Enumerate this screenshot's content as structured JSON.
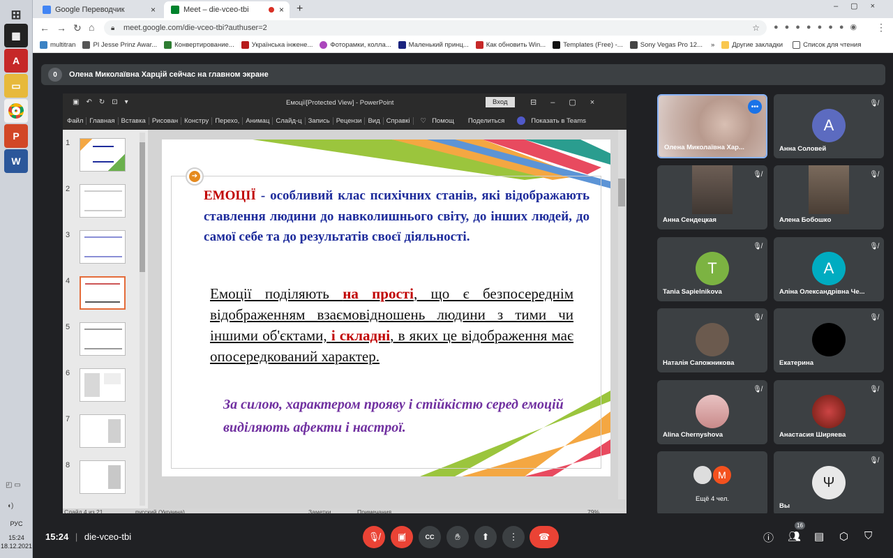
{
  "taskbar": {
    "lang": "РУС",
    "time": "15:24",
    "date": "18.12.2021"
  },
  "tabs": [
    {
      "label": "Google Переводчик"
    },
    {
      "label": "Meet – die-vceo-tbi"
    }
  ],
  "address": {
    "url": "meet.google.com/die-vceo-tbi?authuser=2"
  },
  "bookmarks": {
    "items": [
      "multitran",
      "PI Jesse Prinz Awar...",
      "Конвертирование...",
      "Українська інжене...",
      "Фоторамки, колла...",
      "Маленький принц...",
      "Как обновить Win...",
      "Templates (Free) -...",
      "Sony Vegas Pro 12..."
    ],
    "more": "»",
    "other": "Другие закладки",
    "reading": "Список для чтения"
  },
  "banner": {
    "badge": "0",
    "text": "Олена Миколаївна Харцій сейчас на главном экране"
  },
  "ppt": {
    "title": "Емоції[Protected View]  -  PowerPoint",
    "login": "Вход",
    "ribbon": [
      "Файл",
      "Главная",
      "Вставка",
      "Рисован",
      "Констру",
      "Перехо,",
      "Анимац",
      "Слайд-ц",
      "Запись",
      "Рецензи",
      "Вид",
      "Справкі"
    ],
    "help": "Помощ",
    "share": "Поделиться",
    "teams": "Показать в Teams",
    "thumb_numbers": [
      "1",
      "2",
      "3",
      "4",
      "5",
      "6",
      "7",
      "8"
    ],
    "status": {
      "slide": "Слайд 4 из 21",
      "lang": "русский (Украина)",
      "notes": "Заметки",
      "comments": "Примечания",
      "zoom": "79%"
    },
    "slide": {
      "p1_red": "ЕМОЦІЇ",
      "p1_rest": " - особливий клас психічних станів, які відображають ставлення людини до навколишнього світу, до інших людей, до самої себе та до результатів своєї діяльності.",
      "p2_a": "Емоції поділяють ",
      "p2_red1": "на прості",
      "p2_b": ", що є безпосереднім відображенням взаємовідношень людини з тими чи іншими об'єктами, ",
      "p2_red2": "і складні",
      "p2_c": ", в яких це відображення має опосередкований характер.",
      "p3": "За силою, характером прояву і стійкістю серед емоцій виділяють афекти і настрої."
    }
  },
  "participants": [
    {
      "name": "Олена Миколаївна Хар...",
      "type": "video",
      "color": "#b89a8e"
    },
    {
      "name": "Анна Соловей",
      "letter": "A",
      "color": "#5c6bc0"
    },
    {
      "name": "Анна Сендецкая",
      "type": "video",
      "color": "#6d5e55"
    },
    {
      "name": "Алена Бобошко",
      "type": "video",
      "color": "#7a6a5c"
    },
    {
      "name": "Tania Sapielnikova",
      "letter": "T",
      "color": "#7cb342"
    },
    {
      "name": "Аліна Олександрівна Че...",
      "letter": "A",
      "color": "#00acc1"
    },
    {
      "name": "Наталія Сапожникова",
      "type": "photo",
      "color": "#6b5a4e"
    },
    {
      "name": "Екатерина",
      "type": "photo",
      "color": "#000000"
    },
    {
      "name": "Alina Chernyshova",
      "type": "photo",
      "color": "#d9a6a6"
    },
    {
      "name": "Анастасия Ширяева",
      "type": "photo",
      "color": "#a63a2a"
    },
    {
      "name": "Ещё 4 чел.",
      "type": "more",
      "letter": "M",
      "color": "#f4511e"
    },
    {
      "name": "Вы",
      "type": "photo",
      "color": "#e8e8e8"
    }
  ],
  "bottom": {
    "time": "15:24",
    "separator": "|",
    "code": "die-vceo-tbi",
    "people_count": "16"
  }
}
